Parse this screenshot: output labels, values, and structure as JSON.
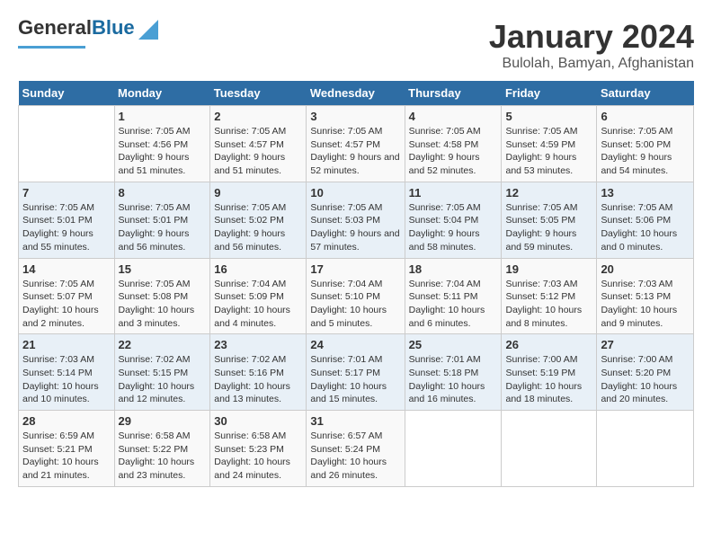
{
  "logo": {
    "line1": "General",
    "line2": "Blue"
  },
  "title": "January 2024",
  "subtitle": "Bulolah, Bamyan, Afghanistan",
  "days_header": [
    "Sunday",
    "Monday",
    "Tuesday",
    "Wednesday",
    "Thursday",
    "Friday",
    "Saturday"
  ],
  "weeks": [
    [
      {
        "num": "",
        "sunrise": "",
        "sunset": "",
        "daylight": ""
      },
      {
        "num": "1",
        "sunrise": "Sunrise: 7:05 AM",
        "sunset": "Sunset: 4:56 PM",
        "daylight": "Daylight: 9 hours and 51 minutes."
      },
      {
        "num": "2",
        "sunrise": "Sunrise: 7:05 AM",
        "sunset": "Sunset: 4:57 PM",
        "daylight": "Daylight: 9 hours and 51 minutes."
      },
      {
        "num": "3",
        "sunrise": "Sunrise: 7:05 AM",
        "sunset": "Sunset: 4:57 PM",
        "daylight": "Daylight: 9 hours and 52 minutes."
      },
      {
        "num": "4",
        "sunrise": "Sunrise: 7:05 AM",
        "sunset": "Sunset: 4:58 PM",
        "daylight": "Daylight: 9 hours and 52 minutes."
      },
      {
        "num": "5",
        "sunrise": "Sunrise: 7:05 AM",
        "sunset": "Sunset: 4:59 PM",
        "daylight": "Daylight: 9 hours and 53 minutes."
      },
      {
        "num": "6",
        "sunrise": "Sunrise: 7:05 AM",
        "sunset": "Sunset: 5:00 PM",
        "daylight": "Daylight: 9 hours and 54 minutes."
      }
    ],
    [
      {
        "num": "7",
        "sunrise": "Sunrise: 7:05 AM",
        "sunset": "Sunset: 5:01 PM",
        "daylight": "Daylight: 9 hours and 55 minutes."
      },
      {
        "num": "8",
        "sunrise": "Sunrise: 7:05 AM",
        "sunset": "Sunset: 5:01 PM",
        "daylight": "Daylight: 9 hours and 56 minutes."
      },
      {
        "num": "9",
        "sunrise": "Sunrise: 7:05 AM",
        "sunset": "Sunset: 5:02 PM",
        "daylight": "Daylight: 9 hours and 56 minutes."
      },
      {
        "num": "10",
        "sunrise": "Sunrise: 7:05 AM",
        "sunset": "Sunset: 5:03 PM",
        "daylight": "Daylight: 9 hours and 57 minutes."
      },
      {
        "num": "11",
        "sunrise": "Sunrise: 7:05 AM",
        "sunset": "Sunset: 5:04 PM",
        "daylight": "Daylight: 9 hours and 58 minutes."
      },
      {
        "num": "12",
        "sunrise": "Sunrise: 7:05 AM",
        "sunset": "Sunset: 5:05 PM",
        "daylight": "Daylight: 9 hours and 59 minutes."
      },
      {
        "num": "13",
        "sunrise": "Sunrise: 7:05 AM",
        "sunset": "Sunset: 5:06 PM",
        "daylight": "Daylight: 10 hours and 0 minutes."
      }
    ],
    [
      {
        "num": "14",
        "sunrise": "Sunrise: 7:05 AM",
        "sunset": "Sunset: 5:07 PM",
        "daylight": "Daylight: 10 hours and 2 minutes."
      },
      {
        "num": "15",
        "sunrise": "Sunrise: 7:05 AM",
        "sunset": "Sunset: 5:08 PM",
        "daylight": "Daylight: 10 hours and 3 minutes."
      },
      {
        "num": "16",
        "sunrise": "Sunrise: 7:04 AM",
        "sunset": "Sunset: 5:09 PM",
        "daylight": "Daylight: 10 hours and 4 minutes."
      },
      {
        "num": "17",
        "sunrise": "Sunrise: 7:04 AM",
        "sunset": "Sunset: 5:10 PM",
        "daylight": "Daylight: 10 hours and 5 minutes."
      },
      {
        "num": "18",
        "sunrise": "Sunrise: 7:04 AM",
        "sunset": "Sunset: 5:11 PM",
        "daylight": "Daylight: 10 hours and 6 minutes."
      },
      {
        "num": "19",
        "sunrise": "Sunrise: 7:03 AM",
        "sunset": "Sunset: 5:12 PM",
        "daylight": "Daylight: 10 hours and 8 minutes."
      },
      {
        "num": "20",
        "sunrise": "Sunrise: 7:03 AM",
        "sunset": "Sunset: 5:13 PM",
        "daylight": "Daylight: 10 hours and 9 minutes."
      }
    ],
    [
      {
        "num": "21",
        "sunrise": "Sunrise: 7:03 AM",
        "sunset": "Sunset: 5:14 PM",
        "daylight": "Daylight: 10 hours and 10 minutes."
      },
      {
        "num": "22",
        "sunrise": "Sunrise: 7:02 AM",
        "sunset": "Sunset: 5:15 PM",
        "daylight": "Daylight: 10 hours and 12 minutes."
      },
      {
        "num": "23",
        "sunrise": "Sunrise: 7:02 AM",
        "sunset": "Sunset: 5:16 PM",
        "daylight": "Daylight: 10 hours and 13 minutes."
      },
      {
        "num": "24",
        "sunrise": "Sunrise: 7:01 AM",
        "sunset": "Sunset: 5:17 PM",
        "daylight": "Daylight: 10 hours and 15 minutes."
      },
      {
        "num": "25",
        "sunrise": "Sunrise: 7:01 AM",
        "sunset": "Sunset: 5:18 PM",
        "daylight": "Daylight: 10 hours and 16 minutes."
      },
      {
        "num": "26",
        "sunrise": "Sunrise: 7:00 AM",
        "sunset": "Sunset: 5:19 PM",
        "daylight": "Daylight: 10 hours and 18 minutes."
      },
      {
        "num": "27",
        "sunrise": "Sunrise: 7:00 AM",
        "sunset": "Sunset: 5:20 PM",
        "daylight": "Daylight: 10 hours and 20 minutes."
      }
    ],
    [
      {
        "num": "28",
        "sunrise": "Sunrise: 6:59 AM",
        "sunset": "Sunset: 5:21 PM",
        "daylight": "Daylight: 10 hours and 21 minutes."
      },
      {
        "num": "29",
        "sunrise": "Sunrise: 6:58 AM",
        "sunset": "Sunset: 5:22 PM",
        "daylight": "Daylight: 10 hours and 23 minutes."
      },
      {
        "num": "30",
        "sunrise": "Sunrise: 6:58 AM",
        "sunset": "Sunset: 5:23 PM",
        "daylight": "Daylight: 10 hours and 24 minutes."
      },
      {
        "num": "31",
        "sunrise": "Sunrise: 6:57 AM",
        "sunset": "Sunset: 5:24 PM",
        "daylight": "Daylight: 10 hours and 26 minutes."
      },
      {
        "num": "",
        "sunrise": "",
        "sunset": "",
        "daylight": ""
      },
      {
        "num": "",
        "sunrise": "",
        "sunset": "",
        "daylight": ""
      },
      {
        "num": "",
        "sunrise": "",
        "sunset": "",
        "daylight": ""
      }
    ]
  ]
}
